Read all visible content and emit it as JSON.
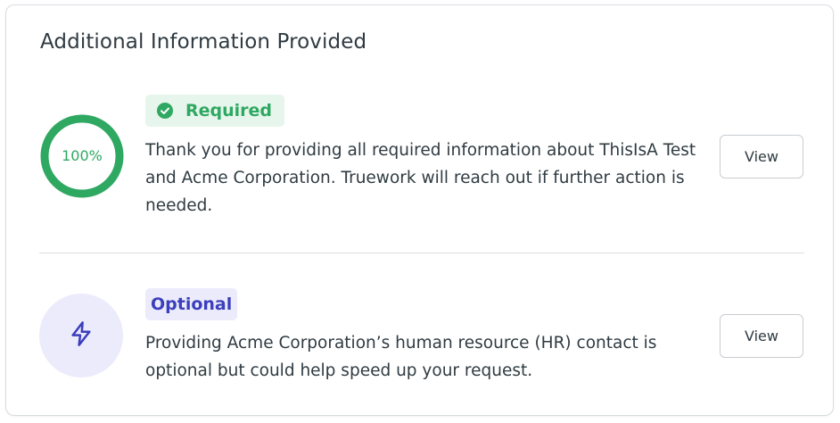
{
  "card": {
    "title": "Additional Information Provided"
  },
  "required_section": {
    "progress_label": "100%",
    "progress_value": 1.0,
    "badge_label": "Required",
    "badge_icon": "check-circle-icon",
    "description": "Thank you for providing all required information about ThisIsA Test and Acme Corporation. Truework will reach out if further action is needed.",
    "view_label": "View"
  },
  "optional_section": {
    "icon": "lightning-bolt-icon",
    "badge_label": "Optional",
    "description": "Providing Acme Corporation’s human resource (HR) contact is optional but could help speed up your request.",
    "view_label": "View"
  },
  "colors": {
    "success_green": "#2fa862",
    "success_bg": "#e7f6ec",
    "optional_purple": "#3c3fbd",
    "optional_bg": "#ecebfb",
    "text": "#2f3b42",
    "border": "#d9dde1"
  }
}
